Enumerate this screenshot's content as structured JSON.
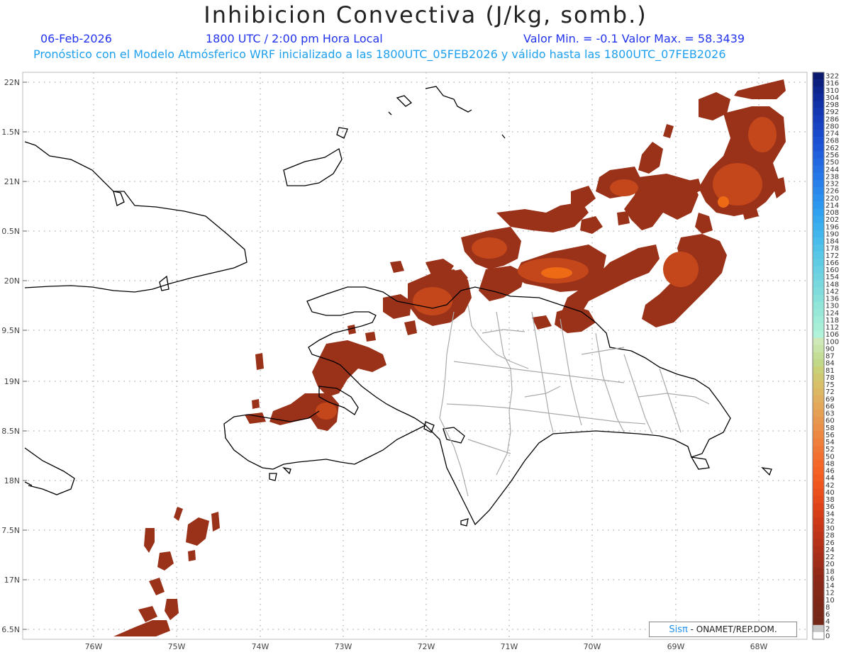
{
  "header": {
    "title": "Inhibicion Convectiva (J/kg, somb.)",
    "date": "06-Feb-2026",
    "time": "1800 UTC / 2:00 pm Hora Local",
    "min_max": "Valor Min. = -0.1  Valor Max. = 58.3439",
    "forecast_line": "Pronóstico con el Modelo Atmósferico WRF inicializado a las 1800UTC_05FEB2026 y válido hasta las  1800UTC_07FEB2026"
  },
  "map": {
    "lat_labels": [
      "22N",
      "1.5N",
      "21N",
      "0.5N",
      "20N",
      "9.5N",
      "19N",
      "8.5N",
      "18N",
      "7.5N",
      "17N",
      "6.5N"
    ],
    "lon_labels": [
      "76W",
      "75W",
      "74W",
      "73W",
      "72W",
      "71W",
      "70W",
      "69W",
      "68W"
    ],
    "colors": {
      "coast": "#000000",
      "province_border": "#aaaaaa",
      "cin_dark": "#8b2a18",
      "cin_mid": "#a63c1c",
      "cin_bright": "#f06a10",
      "grid": "#999999"
    }
  },
  "colorbar": {
    "labels": [
      "322",
      "316",
      "310",
      "304",
      "298",
      "292",
      "286",
      "280",
      "274",
      "268",
      "262",
      "256",
      "250",
      "244",
      "238",
      "232",
      "226",
      "220",
      "214",
      "208",
      "202",
      "196",
      "190",
      "184",
      "178",
      "172",
      "166",
      "160",
      "154",
      "148",
      "142",
      "136",
      "130",
      "124",
      "118",
      "112",
      "106",
      "100",
      "90",
      "87",
      "84",
      "81",
      "78",
      "75",
      "72",
      "69",
      "66",
      "63",
      "60",
      "58",
      "56",
      "54",
      "52",
      "50",
      "48",
      "46",
      "44",
      "42",
      "40",
      "38",
      "36",
      "34",
      "32",
      "30",
      "28",
      "26",
      "24",
      "22",
      "20",
      "18",
      "16",
      "14",
      "12",
      "10",
      "8",
      "6",
      "4",
      "2",
      "0"
    ],
    "colors": [
      "#0a1a6e",
      "#0c2080",
      "#0e2690",
      "#102c9c",
      "#1232a8",
      "#1438b2",
      "#163ebc",
      "#1844c4",
      "#1a4acc",
      "#1c50d2",
      "#1e56d8",
      "#2060dc",
      "#2268e0",
      "#2470e4",
      "#2678e8",
      "#2880ea",
      "#2a88ec",
      "#2c90ee",
      "#2e98f0",
      "#30a0f0",
      "#36a8f0",
      "#3cb0ee",
      "#42b6ec",
      "#48bcea",
      "#50c2e8",
      "#58c8e6",
      "#60cce4",
      "#68d0e2",
      "#70d4e0",
      "#78d8de",
      "#80dcdc",
      "#88e0da",
      "#90e4d8",
      "#98e8d8",
      "#a0ecd8",
      "#a8efd8",
      "#b0f2da",
      "#cfe8b8",
      "#c8e4a8",
      "#c4de98",
      "#c0d888",
      "#c8d078",
      "#d0c870",
      "#d8c06a",
      "#dcb864",
      "#e0b060",
      "#e4a85a",
      "#e6a054",
      "#e8984e",
      "#ea9048",
      "#ec8842",
      "#ee803c",
      "#f07836",
      "#f27030",
      "#f4682a",
      "#f46224",
      "#f25c20",
      "#ee561e",
      "#ea501c",
      "#e44a1a",
      "#de4418",
      "#d63e18",
      "#ce3a18",
      "#c63618",
      "#be3418",
      "#b63218",
      "#ae3018",
      "#a62e18",
      "#9e2c18",
      "#962a18",
      "#8e2818",
      "#882818",
      "#842818",
      "#802818",
      "#7c2818",
      "#782818",
      "#742818",
      "#c8c8c8",
      "#ffffff"
    ]
  },
  "credit": {
    "brand": "Sisπ",
    "text": " - ONAMET/REP.DOM."
  }
}
